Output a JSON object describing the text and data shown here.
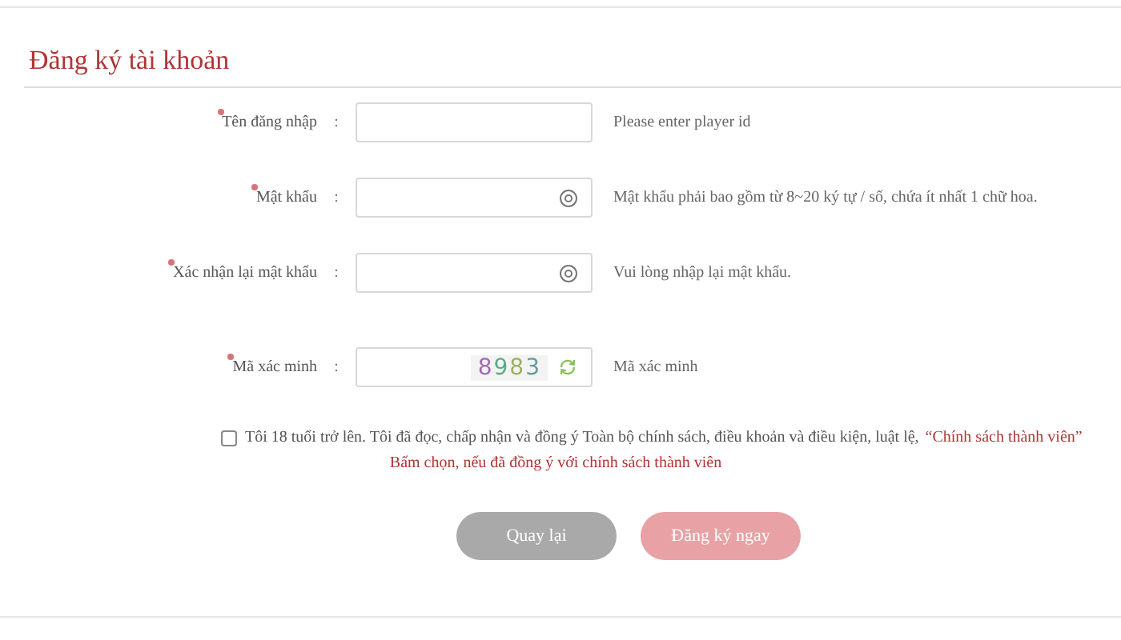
{
  "title": "Đăng ký tài khoản",
  "fields": [
    {
      "kind": "text",
      "label": "Tên đăng nhập",
      "required": true,
      "separator": ":",
      "hint": "Please enter player id"
    },
    {
      "kind": "password",
      "label": "Mật khẩu",
      "required": true,
      "separator": ":",
      "hint": "Mật khẩu phải bao gồm từ 8~20 ký tự / số, chứa ít nhất 1 chữ hoa."
    },
    {
      "kind": "password",
      "label": "Xác nhận lại mật khẩu",
      "required": true,
      "separator": ":",
      "hint": "Vui lòng nhập lại mật khẩu."
    },
    {
      "kind": "captcha",
      "label": "Mã xác minh",
      "required": true,
      "separator": ":",
      "captcha": "8983",
      "hint": "Mã xác minh"
    }
  ],
  "agreement": {
    "checked": false,
    "text": "Tôi 18 tuổi trở lên. Tôi đã đọc, chấp nhận và đồng ý Toàn bộ chính sách, điều khoản và điều kiện, luật lệ,",
    "link": "“Chính sách thành viên”",
    "warning": "Bấm chọn, nếu đã đồng ý với chính sách thành viên"
  },
  "buttons": [
    {
      "kind": "back",
      "label": "Quay lại"
    },
    {
      "kind": "submit",
      "label": "Đăng ký ngay"
    }
  ]
}
